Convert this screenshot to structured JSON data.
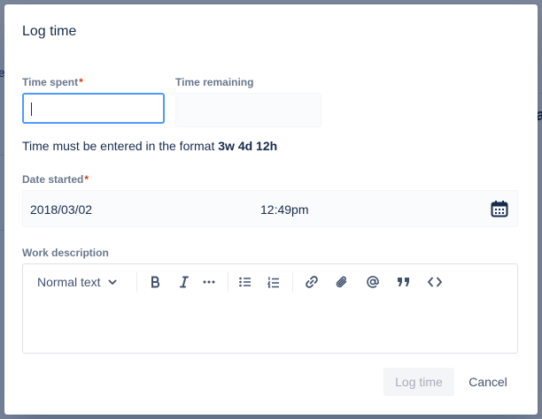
{
  "background": {
    "edge_char_left": "e",
    "edge_char_right": "a"
  },
  "modal": {
    "title": "Log time",
    "time_spent": {
      "label": "Time spent",
      "required_mark": "*",
      "value": ""
    },
    "time_remaining": {
      "label": "Time remaining",
      "value": ""
    },
    "format_hint": {
      "prefix": "Time must be entered in the format ",
      "example": "3w 4d 12h"
    },
    "date_started": {
      "label": "Date started",
      "required_mark": "*",
      "date": "2018/03/02",
      "time": "12:49pm",
      "icon": "calendar-icon"
    },
    "work_description": {
      "label": "Work description",
      "toolbar": {
        "text_style": "Normal text",
        "icons": [
          "chevron-down-icon",
          "bold-icon",
          "italic-icon",
          "more-icon",
          "bullet-list-icon",
          "numbered-list-icon",
          "link-icon",
          "attachment-icon",
          "mention-icon",
          "quote-icon",
          "code-icon"
        ]
      },
      "value": ""
    },
    "buttons": {
      "log_time": "Log time",
      "cancel": "Cancel"
    }
  },
  "colors": {
    "focus_border": "#4c9aff",
    "required": "#de350b",
    "label": "#6b778c",
    "text": "#172b4d",
    "disabled_text": "#a5adba"
  }
}
